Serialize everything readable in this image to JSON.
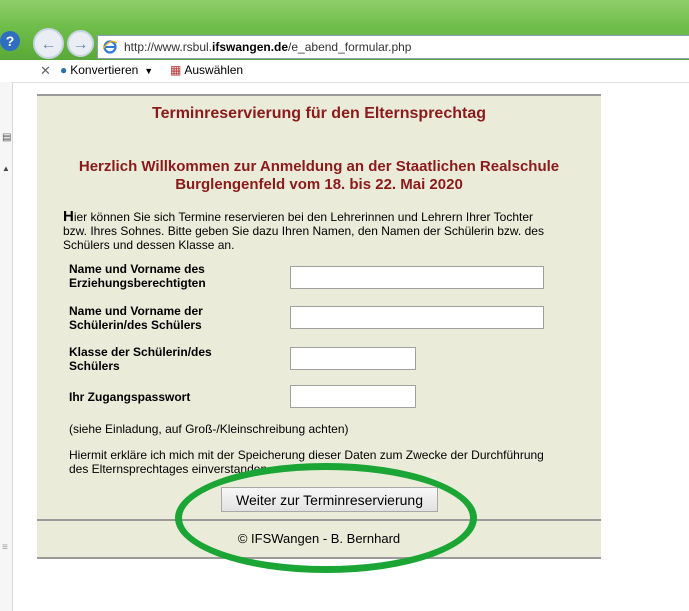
{
  "browser": {
    "url_prefix": "http://www.rsbul.",
    "url_domain": "ifswangen.de",
    "url_path": "/e_abend_formular.php",
    "toolbar_convert": "Konvertieren",
    "toolbar_select": "Auswählen"
  },
  "page": {
    "header_title": "Terminreservierung für den Elternsprechtag",
    "welcome_line1": "Herzlich Willkommen zur Anmeldung an der Staatlichen Realschule",
    "welcome_line2": "Burglengenfeld vom 18. bis 22. Mai 2020",
    "intro_first_letter": "H",
    "intro_line1": "ier können Sie sich Termine reservieren bei den Lehrerinnen und Lehrern Ihrer Tochter",
    "intro_line2": "bzw. Ihres Sohnes. Bitte geben Sie dazu Ihren Namen, den Namen der Schülerin bzw. des",
    "intro_line3": "Schülers und dessen Klasse an.",
    "fields": [
      {
        "label1": "Name und Vorname des",
        "label2": "Erziehungsberechtigten",
        "value": ""
      },
      {
        "label1": "Name und Vorname der",
        "label2": "Schülerin/des Schülers",
        "value": ""
      },
      {
        "label1": "Klasse der Schülerin/des",
        "label2": "Schülers",
        "value": ""
      },
      {
        "label1": "Ihr Zugangspasswort",
        "label2": "",
        "value": ""
      }
    ],
    "password_note": "(siehe Einladung, auf Groß-/Kleinschreibung achten)",
    "consent_line1": "Hiermit erkläre ich mich mit der Speicherung dieser Daten zum Zwecke der Durchführung",
    "consent_line2": "des Elternsprechtages einverstanden.",
    "submit_label": "Weiter zur Terminreservierung",
    "footer": "© IFSWangen - B. Bernhard"
  },
  "colors": {
    "heading": "#8b1a1a",
    "panel_bg": "#ebebda",
    "highlight_ellipse": "#1aa535"
  }
}
